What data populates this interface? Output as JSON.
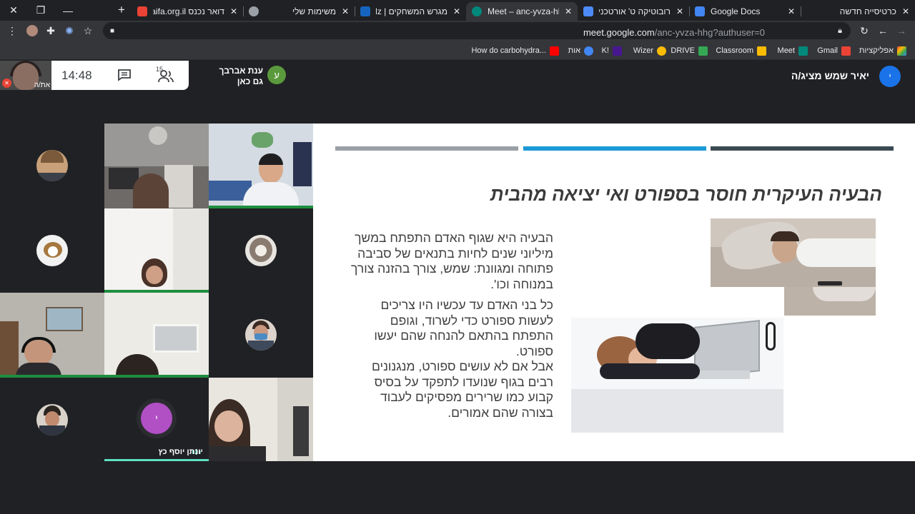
{
  "browser": {
    "tabs": [
      {
        "title": "כרטיסייה חדשה",
        "active": false
      },
      {
        "title": "Google Docs",
        "active": false
      },
      {
        "title": "רובוטיקה ט' אורטכניון ר",
        "active": false
      },
      {
        "title": "Meet – anc-yvza-hh",
        "active": true
      },
      {
        "title": "מגרש המשחקים | Skillz",
        "active": false
      },
      {
        "title": "משימות שלי",
        "active": false
      },
      {
        "title": "דואר נכנס haifa.org.il",
        "active": false
      }
    ],
    "url_host": "meet.google.com",
    "url_path": "/anc-yvza-hhg?authuser=0",
    "bookmarks": [
      {
        "label": "אפליקציות",
        "icon": "apps-grid-icon",
        "color": "#ea4335"
      },
      {
        "label": "Gmail",
        "icon": "gmail-icon",
        "color": "#ea4335"
      },
      {
        "label": "Meet",
        "icon": "meet-icon",
        "color": "#00897b"
      },
      {
        "label": "Classroom",
        "icon": "classroom-icon",
        "color": "#fbbc04"
      },
      {
        "label": "DRIVE",
        "icon": "drive-icon",
        "color": "#34a853"
      },
      {
        "label": "Wizer",
        "icon": "bulb-icon",
        "color": "#fbbc04"
      },
      {
        "label": "K!",
        "icon": "kahoot-icon",
        "color": "#46178f"
      },
      {
        "label": "אות",
        "icon": "chrome-icon",
        "color": "#4285f4"
      },
      {
        "label": "How do carbohydra...",
        "icon": "youtube-icon",
        "color": "#ff0000"
      }
    ]
  },
  "meet": {
    "self_label": "את/ה",
    "clock": "14:48",
    "participants_count": "15",
    "join_name": "ענת אברבך",
    "join_status": "גם כאן",
    "join_initial": "ע",
    "presenter_text": "יאיר שמש מציג/ה",
    "presenter_initial": "י",
    "speaker_name": "יונתן יוסף כץ",
    "speaker_initial": "י"
  },
  "slide": {
    "title": "הבעיה העיקרית חוסר בספורט    ואי יציאה מהבית",
    "para1": "הבעיה היא שגוף האדם התפתח במשך מיליוני שנים לחיות בתנאים של סביבה פתוחה ומגוונת: שמש, צורך בהזנה צורך במנוחה וכו'.",
    "para2": "כל בני האדם עד עכשיו היו צריכים לעשות ספורט כדי לשרוד, וגופם התפתח בהתאם להנחה שהם יעשו ספורט.",
    "para3": "אבל אם לא עושים ספורט, מנגנונים רבים בגוף שנועדו לתפקד על בסיס קבוע כמו שרירים מפסיקים לעבוד בצורה שהם אמורים."
  }
}
